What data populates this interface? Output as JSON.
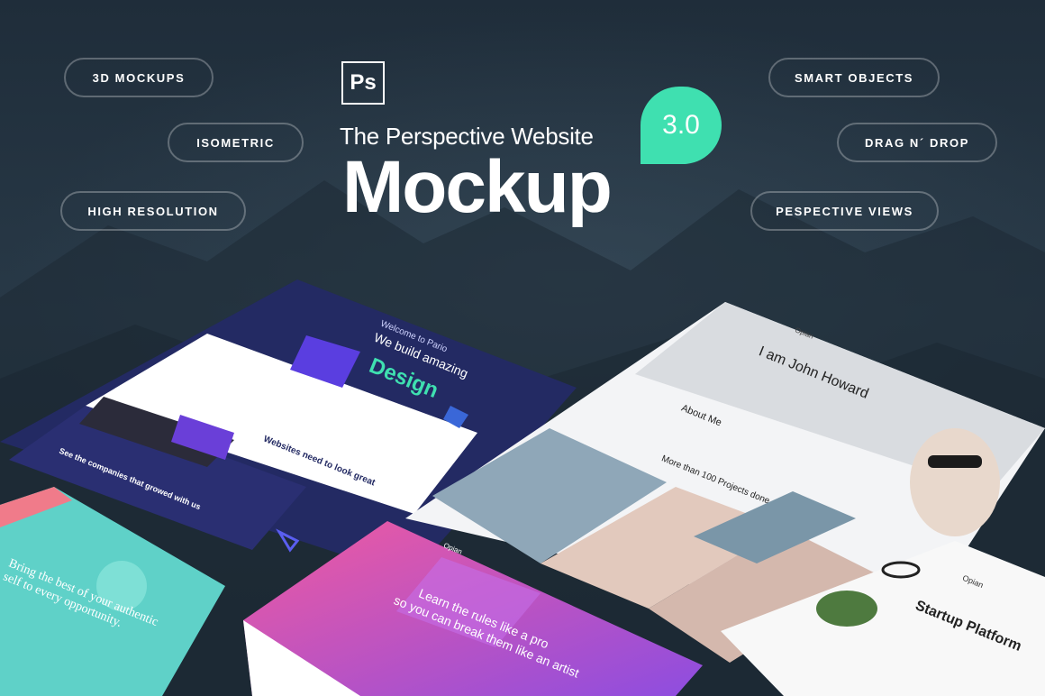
{
  "features_left": [
    "3D MOCKUPS",
    "ISOMETRIC",
    "HIGH RESOLUTION"
  ],
  "features_right": [
    "SMART OBJECTS",
    "DRAG N´ DROP",
    "PESPECTIVE VIEWS"
  ],
  "logo": {
    "text": "Ps",
    "icon": "photoshop-icon"
  },
  "heading": {
    "subtitle": "The Perspective Website",
    "title": "Mockup",
    "version": "3.0"
  },
  "mockups": {
    "agency": {
      "hero_line1": "Welcome to Pario",
      "hero_line2": "We build amazing",
      "hero_word": "Design",
      "block_title": "Websites need to look great",
      "companies": "See the companies that growed with us"
    },
    "portfolio": {
      "brand": "Opian",
      "name": "I am John Howard",
      "about": "About Me",
      "projects": "More than 100 Projects done"
    },
    "teal": {
      "headline": "Bring the best of your authentic self to every opportunity."
    },
    "purple": {
      "brand": "Opian",
      "line1": "Learn the rules like a pro",
      "line2": "so you can break them like an artist"
    },
    "startup": {
      "brand": "Opian",
      "headline": "Startup Platform"
    }
  },
  "colors": {
    "accent": "#3fe0b0",
    "background": "#23313f",
    "navy": "#232a63",
    "purple": "#b04ed8",
    "pink": "#f05aa0"
  }
}
